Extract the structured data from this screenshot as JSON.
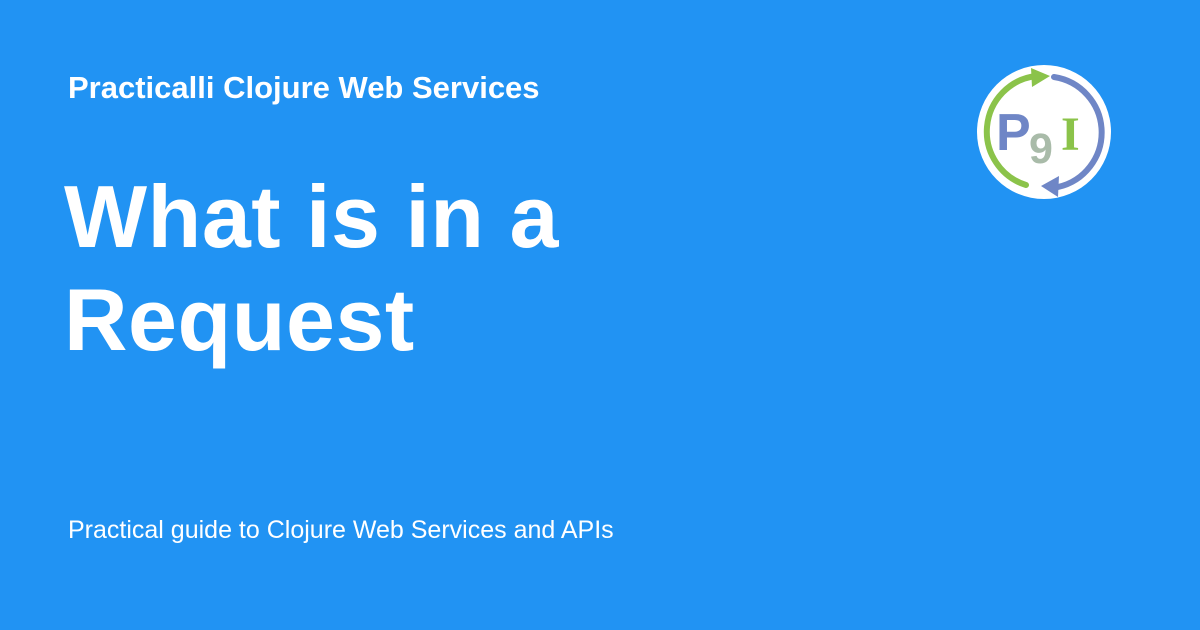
{
  "colors": {
    "background": "#2193f3",
    "text": "#ffffff",
    "logo_green": "#8bc34a",
    "logo_blue": "#6f86c6",
    "logo_grey": "#a9bba9"
  },
  "site": {
    "name": "Practicalli Clojure Web Services"
  },
  "page": {
    "title_line_1": "What is in a",
    "title_line_2": "Request",
    "description": "Practical guide to Clojure Web Services and APIs"
  },
  "logo": {
    "icon": "practicalli-logo-icon",
    "letters": [
      "P",
      "9",
      "I"
    ]
  }
}
